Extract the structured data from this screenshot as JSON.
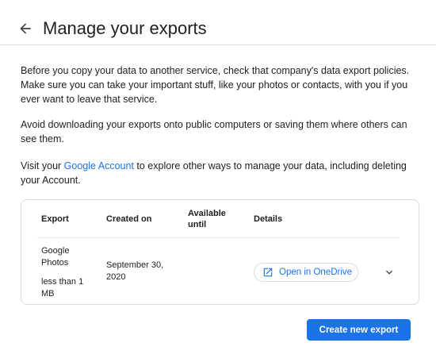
{
  "header": {
    "title": "Manage your exports",
    "back_icon": "arrow-back-icon"
  },
  "intro": {
    "p1": "Before you copy your data to another service, check that company's data export policies. Make sure you can take your important stuff, like your photos or contacts, with you if you ever want to leave that service.",
    "p2": "Avoid downloading your exports onto public computers or saving them where others can see them.",
    "p3_before": "Visit your ",
    "p3_link": "Google Account",
    "p3_after": " to explore other ways to manage your data, including deleting your Account."
  },
  "table": {
    "headers": {
      "export": "Export",
      "created_on": "Created on",
      "available_until": "Available until",
      "details": "Details"
    },
    "rows": [
      {
        "export_name": "Google Photos",
        "export_size": "less than 1 MB",
        "created_on": "September 30, 2020",
        "available_until": "",
        "details_button": "Open in OneDrive",
        "details_icon": "open-in-new-icon",
        "expand_icon": "chevron-down-icon"
      }
    ]
  },
  "actions": {
    "create_label": "Create new export"
  },
  "colors": {
    "accent": "#1a73e8",
    "text": "#202124",
    "border": "#dadce0"
  }
}
